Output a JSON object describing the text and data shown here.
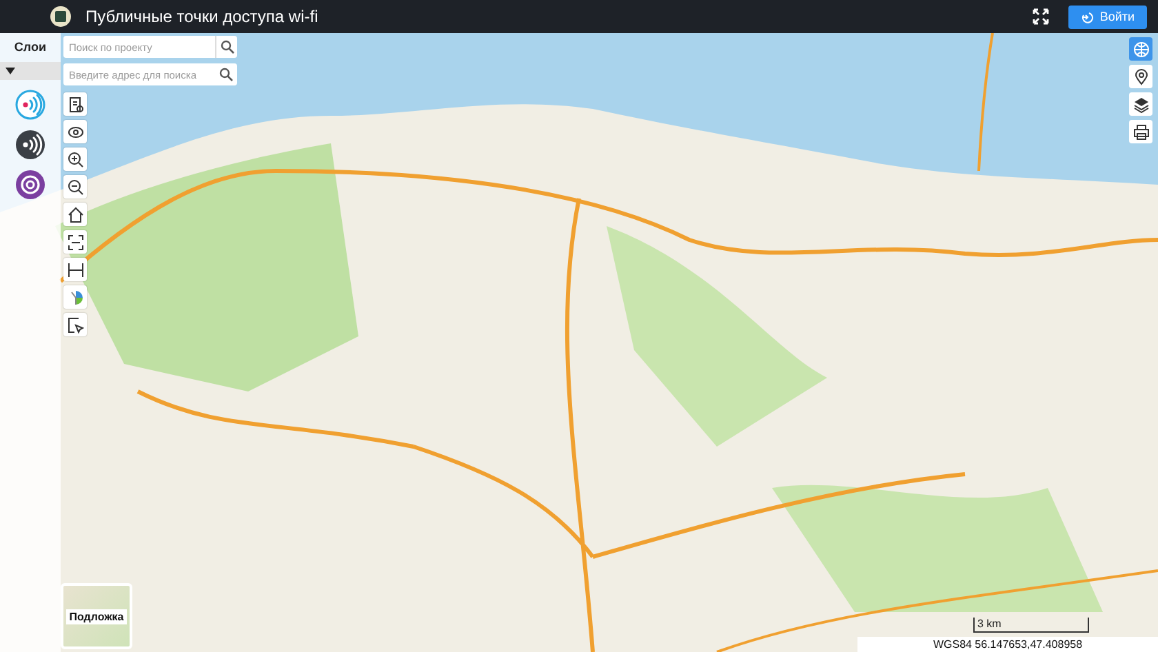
{
  "header": {
    "title": "Публичные точки доступа wi-fi",
    "login_button": "Войти"
  },
  "layers_panel": {
    "title": "Слои",
    "layers": [
      {
        "kind": "wifi-light"
      },
      {
        "kind": "wifi-dark"
      },
      {
        "kind": "target"
      }
    ]
  },
  "search": {
    "project_placeholder": "Поиск по проекту",
    "address_placeholder": "Введите адрес для поиска"
  },
  "tools": [
    {
      "kind": "legend"
    },
    {
      "kind": "eye"
    },
    {
      "kind": "zoom-in"
    },
    {
      "kind": "zoom-out"
    },
    {
      "kind": "home"
    },
    {
      "kind": "extent"
    },
    {
      "kind": "measure"
    },
    {
      "kind": "pie"
    },
    {
      "kind": "select"
    }
  ],
  "right_tools": [
    {
      "kind": "globe",
      "selected": true
    },
    {
      "kind": "pin",
      "selected": false
    },
    {
      "kind": "layers",
      "selected": false
    },
    {
      "kind": "print",
      "selected": false
    }
  ],
  "basemap": {
    "label": "Подложка"
  },
  "scale": "3 km",
  "coordinates": "WGS84 56.147653,47.408958"
}
